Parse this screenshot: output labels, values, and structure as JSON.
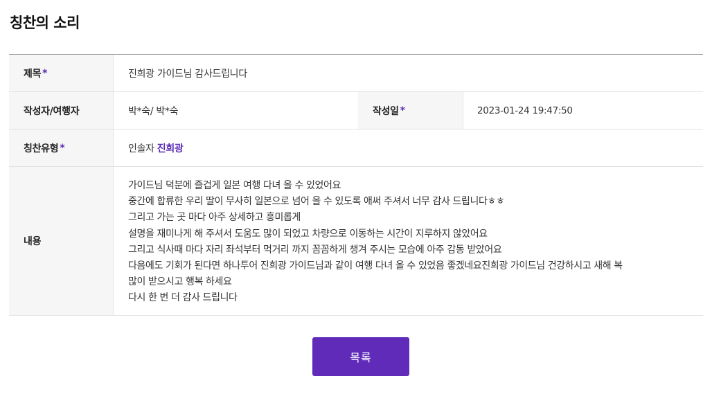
{
  "page": {
    "title": "칭찬의 소리"
  },
  "fields": {
    "subject_label": "제목",
    "subject_value": "진희광 가이드님 감사드립니다",
    "writer_label": "작성자/여행자",
    "writer_value": "박*숙/ 박*숙",
    "date_label": "작성일",
    "date_value": "2023-01-24 19:47:50",
    "type_label": "칭찬유형",
    "type_role": "인솔자",
    "type_name": "진희광",
    "content_label": "내용",
    "required_mark": "*"
  },
  "content_lines": [
    "가이드님 덕분에 즐겁게 일본 여행 다녀 올 수 있었어요",
    "중간에 합류한 우리 딸이 무사히 일본으로 넘어 올 수 있도록 애써 주셔서 너무 감사 드립니다ㅎㅎ",
    "그리고 가는 곳 마다 아주 상세하고 흥미롭게",
    "설명을 재미나게 해 주셔서 도움도 많이 되었고 차량으로 이동하는 시간이 지루하지 않았어요",
    "그리고 식사때 마다 자리 좌석부터 먹거리 까지 꼼꼼하게 챙겨 주시는 모습에 아주 감동 받았어요",
    "다음에도 기회가 된다면 하나투어 진희광 가이드님과 같이 여행 다녀 올 수 있었음 좋겠네요진희광 가이드님 건강하시고 새해 복",
    "많이 받으시고 행복 하세요",
    "다시 한 번 더 감사 드립니다"
  ],
  "actions": {
    "list_button_label": "목록"
  },
  "colors": {
    "accent": "#5f2bb8",
    "header_bg": "#f6f6f6",
    "border": "#e2e2e2"
  }
}
